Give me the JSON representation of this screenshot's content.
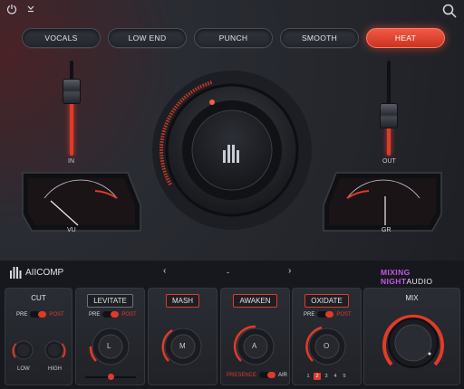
{
  "header": {
    "power_icon": "power-icon",
    "menu_icon": "chevron-down-icon",
    "search_icon": "search-icon"
  },
  "presets": [
    {
      "label": "VOCALS",
      "active": false
    },
    {
      "label": "LOW END",
      "active": false
    },
    {
      "label": "PUNCH",
      "active": false
    },
    {
      "label": "SMOOTH",
      "active": false
    },
    {
      "label": "HEAT",
      "active": true
    }
  ],
  "faders": {
    "in_label": "IN",
    "out_label": "OUT"
  },
  "meters": {
    "left_label": "VU",
    "right_label": "GR"
  },
  "brand": {
    "product": "AIICOMP",
    "preset_name": "-",
    "vendor_a": "MIXING NIGHT",
    "vendor_b": "AUDIO"
  },
  "modules": {
    "cut": {
      "title": "CUT",
      "pre": "PRE",
      "post": "POST",
      "low": "LOW",
      "high": "HIGH"
    },
    "levitate": {
      "title": "LEVITATE",
      "pre": "PRE",
      "post": "POST",
      "knob": "L"
    },
    "mash": {
      "title": "MASH",
      "knob": "M"
    },
    "awaken": {
      "title": "AWAKEN",
      "knob": "A",
      "presence": "PRESENCE",
      "air": "AIR"
    },
    "oxidate": {
      "title": "OXIDATE",
      "pre": "PRE",
      "post": "POST",
      "knob": "O",
      "modes": [
        "1",
        "2",
        "3",
        "4",
        "5"
      ],
      "active_mode": "2"
    },
    "mix": {
      "title": "MIX"
    }
  },
  "colors": {
    "accent": "#e23a2a",
    "panel": "#2a2d34",
    "background": "#1d1f24"
  }
}
